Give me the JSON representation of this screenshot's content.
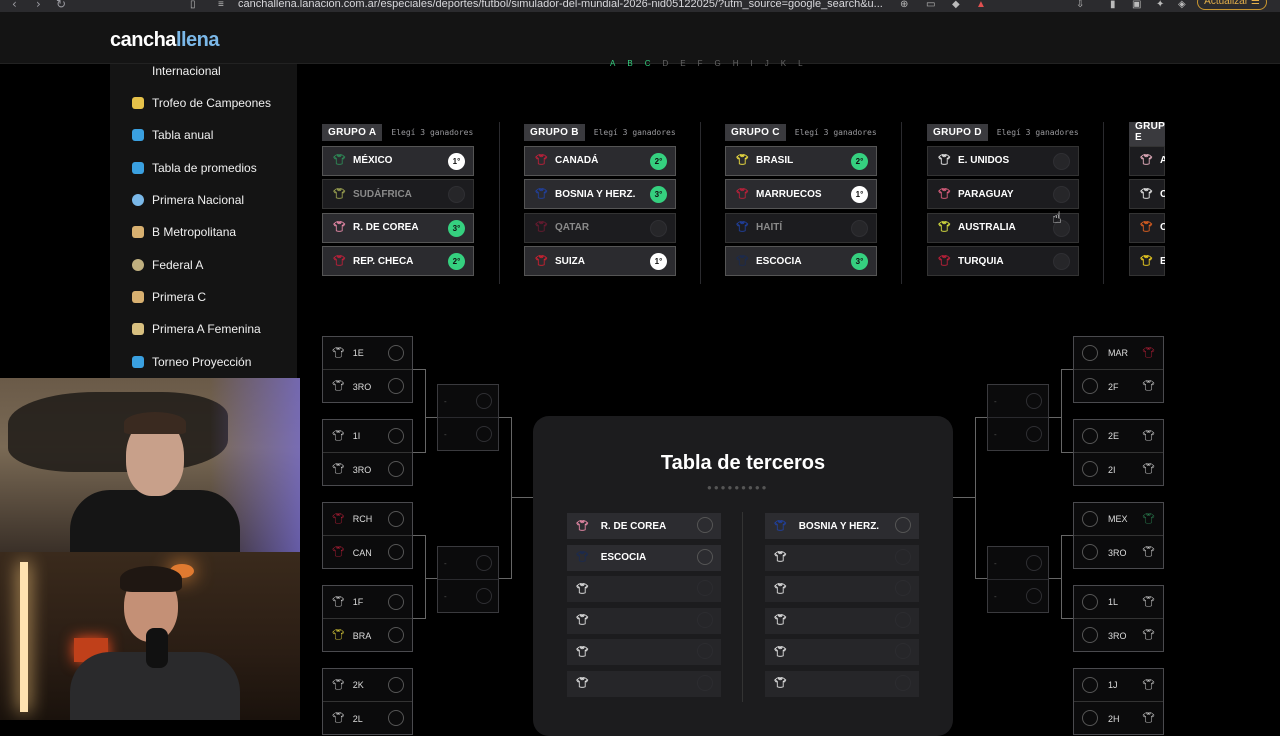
{
  "browser": {
    "url": "canchallena.lanacion.com.ar/especiales/deportes/futbol/simulador-del-mundial-2026-nid05122025/?utm_source=google_search&u...",
    "update_label": "Actualizar ☰"
  },
  "site": {
    "logo_part1": "cancha",
    "logo_part2": "llena"
  },
  "sidebar": {
    "items": [
      {
        "label": "Internacional",
        "icon": "globe-icon",
        "color": "#888888"
      },
      {
        "label": "Trofeo de Campeones",
        "icon": "trophy-icon",
        "color": "#e6c24a"
      },
      {
        "label": "Tabla anual",
        "icon": "table-icon",
        "color": "#3aa0e0"
      },
      {
        "label": "Tabla de promedios",
        "icon": "table-icon",
        "color": "#3aa0e0"
      },
      {
        "label": "Primera Nacional",
        "icon": "ball-icon",
        "color": "#7ab8e8"
      },
      {
        "label": "B Metropolitana",
        "icon": "shield-icon",
        "color": "#d8b070"
      },
      {
        "label": "Federal A",
        "icon": "badge-icon",
        "color": "#c0b080"
      },
      {
        "label": "Primera C",
        "icon": "shield-icon",
        "color": "#d8b070"
      },
      {
        "label": "Primera A Femenina",
        "icon": "shield-icon",
        "color": "#d8c080"
      },
      {
        "label": "Torneo Proyección",
        "icon": "table-icon",
        "color": "#3aa0e0"
      }
    ]
  },
  "group_letters": [
    "A",
    "B",
    "C",
    "D",
    "E",
    "F",
    "G",
    "H",
    "I",
    "J",
    "K",
    "L"
  ],
  "groups": [
    {
      "title": "GRUPO A",
      "sub": "Elegí 3 ganadores",
      "teams": [
        {
          "name": "MÉXICO",
          "pos": "1°",
          "style": "white",
          "shirt": "#2e8b57",
          "state": "sel"
        },
        {
          "name": "SUDÁFRICA",
          "pos": "",
          "style": "empty",
          "shirt": "#9aa050",
          "state": "dim"
        },
        {
          "name": "R. DE COREA",
          "pos": "3°",
          "style": "green",
          "shirt": "#e88aa8",
          "state": "sel"
        },
        {
          "name": "REP. CHECA",
          "pos": "2°",
          "style": "green",
          "shirt": "#c0203a",
          "state": "sel"
        }
      ]
    },
    {
      "title": "GRUPO B",
      "sub": "Elegí 3 ganadores",
      "teams": [
        {
          "name": "CANADÁ",
          "pos": "2°",
          "style": "green",
          "shirt": "#c0203a",
          "state": "sel"
        },
        {
          "name": "BOSNIA Y HERZ.",
          "pos": "3°",
          "style": "green",
          "shirt": "#2040a0",
          "state": "sel"
        },
        {
          "name": "QATAR",
          "pos": "",
          "style": "empty",
          "shirt": "#6a1a30",
          "state": "dim"
        },
        {
          "name": "SUIZA",
          "pos": "1°",
          "style": "white",
          "shirt": "#d02030",
          "state": "sel"
        }
      ]
    },
    {
      "title": "GRUPO C",
      "sub": "Elegí 3 ganadores",
      "teams": [
        {
          "name": "BRASIL",
          "pos": "2°",
          "style": "green",
          "shirt": "#f0e040",
          "state": "sel"
        },
        {
          "name": "MARRUECOS",
          "pos": "1°",
          "style": "white",
          "shirt": "#c0203a",
          "state": "sel"
        },
        {
          "name": "HAITÍ",
          "pos": "",
          "style": "empty",
          "shirt": "#2040a0",
          "state": "dim"
        },
        {
          "name": "ESCOCIA",
          "pos": "3°",
          "style": "green",
          "shirt": "#1a2a50",
          "state": "sel"
        }
      ]
    },
    {
      "title": "GRUPO D",
      "sub": "Elegí 3 ganadores",
      "teams": [
        {
          "name": "E. UNIDOS",
          "pos": "",
          "style": "empty",
          "shirt": "#e8e8e8",
          "state": ""
        },
        {
          "name": "PARAGUAY",
          "pos": "",
          "style": "empty",
          "shirt": "#e06080",
          "state": ""
        },
        {
          "name": "AUSTRALIA",
          "pos": "",
          "style": "empty",
          "shirt": "#d8e040",
          "state": ""
        },
        {
          "name": "TURQUIA",
          "pos": "",
          "style": "empty",
          "shirt": "#c0203a",
          "state": ""
        }
      ]
    },
    {
      "title": "GRUPO E",
      "sub": "",
      "teams": [
        {
          "name": "A",
          "pos": "",
          "style": "",
          "shirt": "#e8b0c0",
          "state": ""
        },
        {
          "name": "C",
          "pos": "",
          "style": "",
          "shirt": "#e8e8e8",
          "state": ""
        },
        {
          "name": "C",
          "pos": "",
          "style": "",
          "shirt": "#e06020",
          "state": ""
        },
        {
          "name": "E",
          "pos": "",
          "style": "",
          "shirt": "#f0d020",
          "state": ""
        }
      ]
    }
  ],
  "bracket_left": [
    {
      "top": "1E",
      "bottom": "3RO",
      "top_shirt": "#e0e0e0",
      "bottom_shirt": "#e0e0e0"
    },
    {
      "top": "1I",
      "bottom": "3RO",
      "top_shirt": "#e0e0e0",
      "bottom_shirt": "#e0e0e0"
    },
    {
      "top": "RCH",
      "bottom": "CAN",
      "top_shirt": "#c0203a",
      "bottom_shirt": "#c0203a"
    },
    {
      "top": "1F",
      "bottom": "BRA",
      "top_shirt": "#e0e0e0",
      "bottom_shirt": "#f0e040"
    },
    {
      "top": "2K",
      "bottom": "2L",
      "top_shirt": "#e0e0e0",
      "bottom_shirt": "#e0e0e0"
    }
  ],
  "bracket_right": [
    {
      "top": "MAR",
      "bottom": "2F",
      "top_shirt": "#c0203a",
      "bottom_shirt": "#e0e0e0"
    },
    {
      "top": "2E",
      "bottom": "2I",
      "top_shirt": "#e0e0e0",
      "bottom_shirt": "#e0e0e0"
    },
    {
      "top": "MEX",
      "bottom": "3RO",
      "top_shirt": "#2e8b57",
      "bottom_shirt": "#e0e0e0"
    },
    {
      "top": "1L",
      "bottom": "3RO",
      "top_shirt": "#e0e0e0",
      "bottom_shirt": "#e0e0e0"
    },
    {
      "top": "1J",
      "bottom": "2H",
      "top_shirt": "#e0e0e0",
      "bottom_shirt": "#e0e0e0"
    }
  ],
  "mini_placeholder": "-",
  "terceros": {
    "title": "Tabla de terceros",
    "left": [
      {
        "name": "R. DE COREA",
        "shirt": "#e88aa8"
      },
      {
        "name": "ESCOCIA",
        "shirt": "#1a2a50"
      },
      {
        "name": "",
        "shirt": "#e0e0e0"
      },
      {
        "name": "",
        "shirt": "#e0e0e0"
      },
      {
        "name": "",
        "shirt": "#e0e0e0"
      },
      {
        "name": "",
        "shirt": "#e0e0e0"
      }
    ],
    "right": [
      {
        "name": "BOSNIA Y HERZ.",
        "shirt": "#2040a0"
      },
      {
        "name": "",
        "shirt": "#e0e0e0"
      },
      {
        "name": "",
        "shirt": "#e0e0e0"
      },
      {
        "name": "",
        "shirt": "#e0e0e0"
      },
      {
        "name": "",
        "shirt": "#e0e0e0"
      },
      {
        "name": "",
        "shirt": "#e0e0e0"
      }
    ]
  },
  "colors": {
    "accent_green": "#35d07f",
    "logo_accent": "#7bb8e8"
  }
}
